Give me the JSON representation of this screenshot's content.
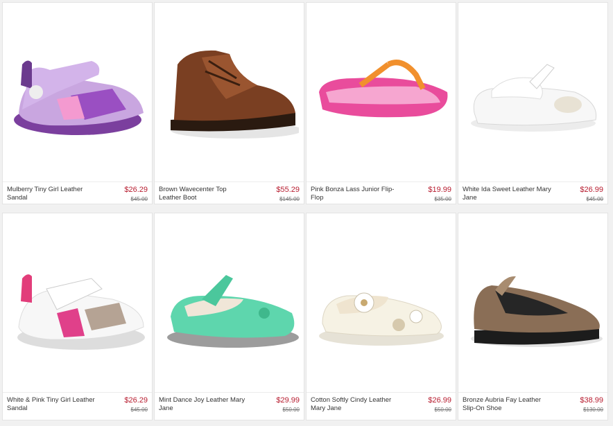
{
  "products": [
    {
      "name": "Mulberry Tiny Girl Leather Sandal",
      "price": "$26.29",
      "orig": "$45.00",
      "icon": "purple-sandal-icon"
    },
    {
      "name": "Brown Wavecenter Top Leather Boot",
      "price": "$55.29",
      "orig": "$145.00",
      "icon": "brown-boot-icon"
    },
    {
      "name": "Pink Bonza Lass Junior Flip-Flop",
      "price": "$19.99",
      "orig": "$35.00",
      "icon": "pink-flipflop-icon"
    },
    {
      "name": "White Ida Sweet Leather Mary Jane",
      "price": "$26.99",
      "orig": "$45.00",
      "icon": "white-maryjane-icon"
    },
    {
      "name": "White & Pink Tiny Girl Leather Sandal",
      "price": "$26.29",
      "orig": "$45.00",
      "icon": "white-pink-sandal-icon"
    },
    {
      "name": "Mint Dance Joy Leather Mary Jane",
      "price": "$29.99",
      "orig": "$50.00",
      "icon": "mint-maryjane-icon"
    },
    {
      "name": "Cotton Softly Cindy Leather Mary Jane",
      "price": "$26.99",
      "orig": "$50.00",
      "icon": "cream-maryjane-icon"
    },
    {
      "name": "Bronze Aubria Fay Leather Slip-On Shoe",
      "price": "$38.99",
      "orig": "$130.00",
      "icon": "bronze-slipon-icon"
    }
  ],
  "colors": {
    "price": "#b71c2f",
    "border": "#e3e3e3"
  }
}
